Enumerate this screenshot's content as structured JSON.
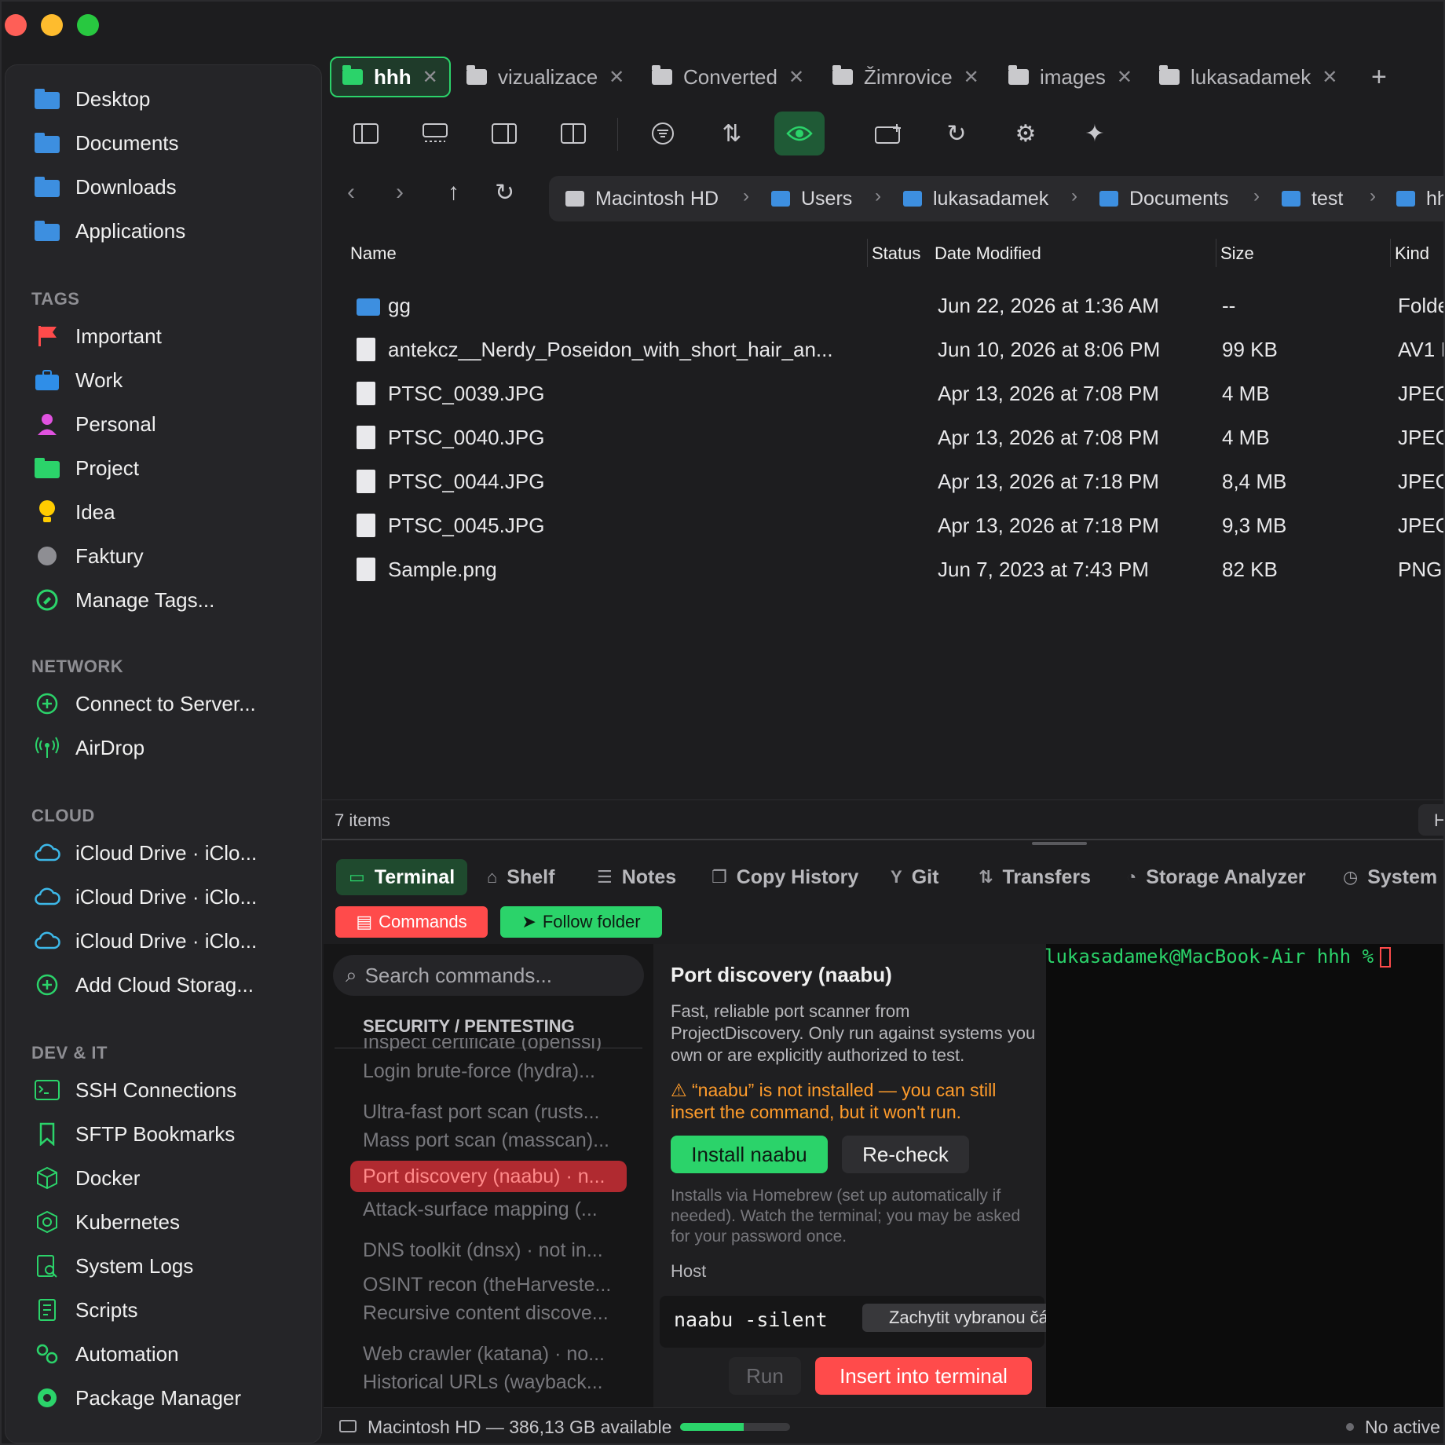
{
  "tabs": [
    {
      "label": "hhh",
      "active": true
    },
    {
      "label": "vizualizace"
    },
    {
      "label": "Converted"
    },
    {
      "label": "Žimrovice"
    },
    {
      "label": "images"
    },
    {
      "label": "lukasadamek"
    }
  ],
  "sidebar": {
    "favorites": [
      "Desktop",
      "Documents",
      "Downloads",
      "Applications"
    ],
    "tags_heading": "TAGS",
    "tags": [
      "Important",
      "Work",
      "Personal",
      "Project",
      "Idea",
      "Faktury",
      "Manage Tags..."
    ],
    "network_heading": "NETWORK",
    "network": [
      "Connect to Server...",
      "AirDrop"
    ],
    "cloud_heading": "CLOUD",
    "cloud": [
      "iCloud Drive · iClo...",
      "iCloud Drive · iClo...",
      "iCloud Drive · iClo...",
      "Add Cloud Storag..."
    ],
    "devit_heading": "DEV & IT",
    "devit": [
      "SSH Connections",
      "SFTP Bookmarks",
      "Docker",
      "Kubernetes",
      "System Logs",
      "Scripts",
      "Automation",
      "Package Manager"
    ]
  },
  "path": [
    "Macintosh HD",
    "Users",
    "lukasadamek",
    "Documents",
    "test",
    "hh"
  ],
  "columns": {
    "name": "Name",
    "status": "Status",
    "date": "Date Modified",
    "size": "Size",
    "kind": "Kind"
  },
  "files": [
    {
      "name": "gg",
      "date": "Jun 22, 2026 at 1:36 AM",
      "size": "--",
      "kind": "Folde",
      "folder": true
    },
    {
      "name": "antekcz__Nerdy_Poseidon_with_short_hair_an...",
      "date": "Jun 10, 2026 at 8:06 PM",
      "size": "99 KB",
      "kind": "AV1 I"
    },
    {
      "name": "PTSC_0039.JPG",
      "date": "Apr 13, 2026 at 7:08 PM",
      "size": "4 MB",
      "kind": "JPEG"
    },
    {
      "name": "PTSC_0040.JPG",
      "date": "Apr 13, 2026 at 7:08 PM",
      "size": "4 MB",
      "kind": "JPEG"
    },
    {
      "name": "PTSC_0044.JPG",
      "date": "Apr 13, 2026 at 7:18 PM",
      "size": "8,4 MB",
      "kind": "JPEG"
    },
    {
      "name": "PTSC_0045.JPG",
      "date": "Apr 13, 2026 at 7:18 PM",
      "size": "9,3 MB",
      "kind": "JPEG"
    },
    {
      "name": "Sample.png",
      "date": "Jun 7, 2023 at 7:43 PM",
      "size": "82 KB",
      "kind": "PNG"
    }
  ],
  "items_count": "7 items",
  "right_edge_label": "H",
  "panel_tabs": [
    "Terminal",
    "Shelf",
    "Notes",
    "Copy History",
    "Git",
    "Transfers",
    "Storage Analyzer",
    "System"
  ],
  "commands_label": "Commands",
  "follow_label": "Follow folder",
  "search_placeholder": "Search commands...",
  "category": "SECURITY / PENTESTING",
  "commands": [
    "Inspect certificate (openssl)",
    "Login brute-force (hydra)...",
    "Ultra-fast port scan (rusts...",
    "Mass port scan (masscan)...",
    "Port discovery (naabu)   · n...",
    "Attack-surface mapping (...",
    "DNS toolkit (dnsx)   · not in...",
    "OSINT recon (theHarveste...",
    "Recursive content discove...",
    "Web crawler (katana)   · no...",
    "Historical URLs (wayback..."
  ],
  "detail": {
    "title": "Port discovery (naabu)",
    "desc": "Fast, reliable port scanner from ProjectDiscovery. Only run against systems you own or are explicitly authorized to test.",
    "warning": "⚠ “naabu” is not installed — you can still insert the command, but it won't run.",
    "install": "Install naabu",
    "recheck": "Re-check",
    "note": "Installs via Homebrew (set up automatically if needed). Watch the terminal; you may be asked for your password once.",
    "host_label": "Host",
    "host_value": "naabu -silent",
    "capture": "Zachytit vybranou část",
    "run": "Run",
    "insert": "Insert into terminal"
  },
  "terminal_prompt": "lukasadamek@MacBook-Air hhh %",
  "disk_status": "Macintosh HD — 386,13 GB available",
  "disk_usage": 0.58,
  "no_active": "No active",
  "colors": {
    "accent": "#2bd36a",
    "danger": "#ff4b4b",
    "warning": "#ff9c2b",
    "folder": "#3d8fe0"
  }
}
